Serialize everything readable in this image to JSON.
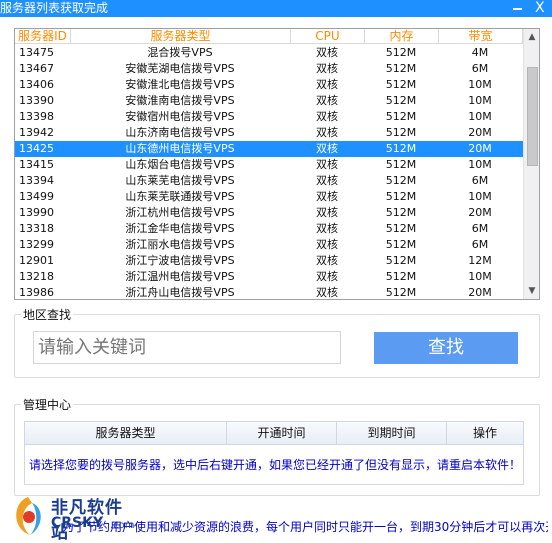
{
  "window": {
    "title": "服务器列表获取完成",
    "close_glyph": "X"
  },
  "server_list": {
    "columns": [
      "服务器ID",
      "服务器类型",
      "CPU",
      "内存",
      "带宽"
    ],
    "rows": [
      {
        "id": "13475",
        "type": "混合拨号VPS",
        "cpu": "双核",
        "mem": "512M",
        "bw": "4M"
      },
      {
        "id": "13467",
        "type": "安徽芜湖电信拨号VPS",
        "cpu": "双核",
        "mem": "512M",
        "bw": "6M"
      },
      {
        "id": "13406",
        "type": "安徽淮北电信拨号VPS",
        "cpu": "双核",
        "mem": "512M",
        "bw": "10M"
      },
      {
        "id": "13390",
        "type": "安徽淮南电信拨号VPS",
        "cpu": "双核",
        "mem": "512M",
        "bw": "10M"
      },
      {
        "id": "13398",
        "type": "安徽宿州电信拨号VPS",
        "cpu": "双核",
        "mem": "512M",
        "bw": "10M"
      },
      {
        "id": "13942",
        "type": "山东济南电信拨号VPS",
        "cpu": "双核",
        "mem": "512M",
        "bw": "20M"
      },
      {
        "id": "13425",
        "type": "山东德州电信拨号VPS",
        "cpu": "双核",
        "mem": "512M",
        "bw": "20M"
      },
      {
        "id": "13415",
        "type": "山东烟台电信拨号VPS",
        "cpu": "双核",
        "mem": "512M",
        "bw": "10M"
      },
      {
        "id": "13394",
        "type": "山东莱芜电信拨号VPS",
        "cpu": "双核",
        "mem": "512M",
        "bw": "6M"
      },
      {
        "id": "13499",
        "type": "山东莱芜联通拨号VPS",
        "cpu": "双核",
        "mem": "512M",
        "bw": "10M"
      },
      {
        "id": "13990",
        "type": "浙江杭州电信拨号VPS",
        "cpu": "双核",
        "mem": "512M",
        "bw": "20M"
      },
      {
        "id": "13318",
        "type": "浙江金华电信拨号VPS",
        "cpu": "双核",
        "mem": "512M",
        "bw": "6M"
      },
      {
        "id": "13299",
        "type": "浙江丽水电信拨号VPS",
        "cpu": "双核",
        "mem": "512M",
        "bw": "6M"
      },
      {
        "id": "12901",
        "type": "浙江宁波电信拨号VPS",
        "cpu": "双核",
        "mem": "512M",
        "bw": "12M"
      },
      {
        "id": "13218",
        "type": "浙江温州电信拨号VPS",
        "cpu": "双核",
        "mem": "512M",
        "bw": "10M"
      },
      {
        "id": "13986",
        "type": "浙江舟山电信拨号VPS",
        "cpu": "双核",
        "mem": "512M",
        "bw": "20M"
      }
    ],
    "selected_id": "13425"
  },
  "region_search": {
    "legend": "地区查找",
    "placeholder": "请输入关键词",
    "button_label": "查找"
  },
  "management": {
    "legend": "管理中心",
    "columns": [
      "服务器类型",
      "开通时间",
      "到期时间",
      "操作"
    ],
    "note": "请选择您要的拨号服务器，选中后右键开通，如果您已经开通了但没有显示，请重启本软件！"
  },
  "footer": {
    "logo_cn": "非凡软件站",
    "logo_en": "CRSKY",
    "logo_com": ".com",
    "notice": "为了节约用户使用和减少资源的浪费，每个用户同时只能开一台，到期30分钟后才可以再次开通"
  },
  "colors": {
    "selection": "#1e90ff",
    "header_text": "#ff8c00",
    "button": "#5b9bf2",
    "note": "#0000cc"
  }
}
